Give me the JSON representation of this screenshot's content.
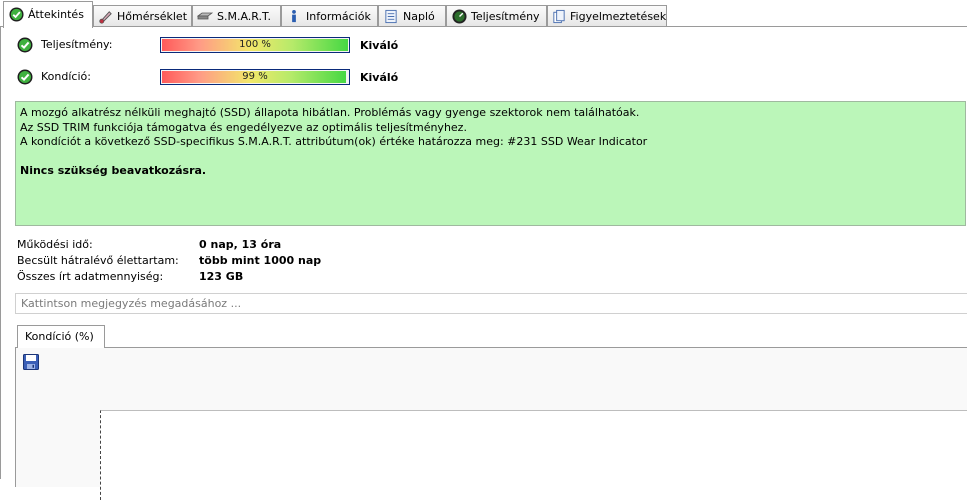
{
  "tabs": [
    {
      "label": "Áttekintés",
      "icon": "check-circle-icon",
      "active": true
    },
    {
      "label": "Hőmérséklet",
      "icon": "thermometer-icon"
    },
    {
      "label": "S.M.A.R.T.",
      "icon": "drive-icon"
    },
    {
      "label": "Információk",
      "icon": "info-icon"
    },
    {
      "label": "Napló",
      "icon": "log-icon"
    },
    {
      "label": "Teljesítmény",
      "icon": "gauge-icon"
    },
    {
      "label": "Figyelmeztetések",
      "icon": "warnings-icon"
    }
  ],
  "status": {
    "performance": {
      "label": "Teljesítmény:",
      "value": 100,
      "percent_text": "100 %",
      "rating": "Kiváló"
    },
    "condition": {
      "label": "Kondíció:",
      "value": 99,
      "percent_text": "99 %",
      "rating": "Kiváló"
    }
  },
  "message": {
    "lines": [
      "A mozgó alkatrész nélküli meghajtó (SSD) állapota hibátlan. Problémás vagy gyenge szektorok nem találhatóak.",
      "Az SSD TRIM funkciója támogatva és engedélyezve az optimális teljesítményhez.",
      "A kondíciót a következő SSD-specifikus S.M.A.R.T. attribútum(ok) értéke határozza meg:  #231 SSD Wear Indicator"
    ],
    "action": "Nincs szükség beavatkozásra."
  },
  "info": [
    {
      "key": "Működési idő:",
      "value": "0 nap, 13 óra"
    },
    {
      "key": "Becsült hátralévő élettartam:",
      "value": "több mint 1000 nap"
    },
    {
      "key": "Összes írt adatmennyiség:",
      "value": "123 GB"
    }
  ],
  "comment": {
    "placeholder": "Kattintson megjegyzés megadásához ..."
  },
  "subtab": {
    "label": "Kondíció  (%)"
  },
  "colors": {
    "message_bg": "#bbf6b9",
    "bar_border": "#0a2a7a",
    "check_green": "#2e9b2e"
  }
}
